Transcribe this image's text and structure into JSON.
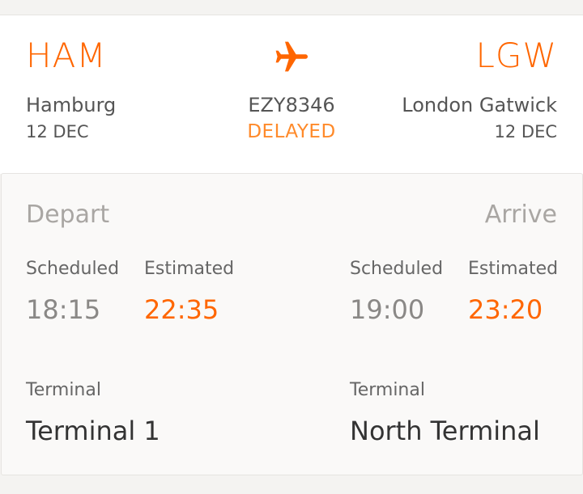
{
  "flight": {
    "origin_code": "HAM",
    "origin_city": "Hamburg",
    "origin_date": "12 DEC",
    "destination_code": "LGW",
    "destination_city": "London Gatwick",
    "destination_date": "12 DEC",
    "number": "EZY8346",
    "status": "DELAYED",
    "icon": "airplane-icon"
  },
  "depart": {
    "title": "Depart",
    "scheduled_label": "Scheduled",
    "scheduled_time": "18:15",
    "estimated_label": "Estimated",
    "estimated_time": "22:35",
    "terminal_label": "Terminal",
    "terminal_value": "Terminal 1"
  },
  "arrive": {
    "title": "Arrive",
    "scheduled_label": "Scheduled",
    "scheduled_time": "19:00",
    "estimated_label": "Estimated",
    "estimated_time": "23:20",
    "terminal_label": "Terminal",
    "terminal_value": "North Terminal"
  },
  "colors": {
    "accent": "#ff6600",
    "status": "#ff8a2a",
    "muted": "#a9a6a3"
  }
}
